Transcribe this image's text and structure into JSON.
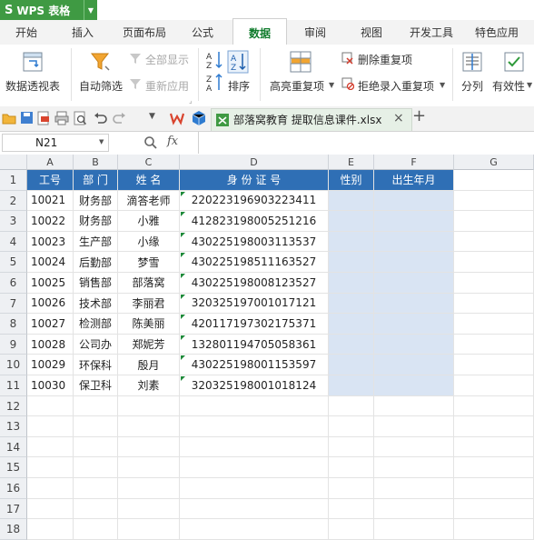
{
  "app": {
    "name": "WPS 表格",
    "logo_letter": "S"
  },
  "menu": {
    "tabs": [
      {
        "label": "开始"
      },
      {
        "label": "插入"
      },
      {
        "label": "页面布局"
      },
      {
        "label": "公式"
      },
      {
        "label": "数据",
        "active": true
      },
      {
        "label": "审阅"
      },
      {
        "label": "视图"
      },
      {
        "label": "开发工具"
      },
      {
        "label": "特色应用"
      }
    ]
  },
  "ribbon": {
    "pivot": "数据透视表",
    "autofilter": "自动筛选",
    "show_all": "全部显示",
    "reapply": "重新应用",
    "sort": "排序",
    "highlight_dup": "高亮重复项",
    "remove_dup": "删除重复项",
    "reject_dup": "拒绝录入重复项",
    "split": "分列",
    "validity": "有效性"
  },
  "doc_tab": {
    "title": "部落窝教育 提取信息课件.xlsx",
    "close": "×",
    "add": "+"
  },
  "formula_bar": {
    "cell_ref": "N21",
    "fx": "fx",
    "zoom_icon": "magnifier-icon",
    "content": ""
  },
  "columns": [
    "A",
    "B",
    "C",
    "D",
    "E",
    "F",
    "G"
  ],
  "table": {
    "headers": [
      "工号",
      "部  门",
      "姓  名",
      "身 份 证 号",
      "性别",
      "出生年月"
    ],
    "rows": [
      [
        "10021",
        "财务部",
        "滴答老师",
        "220223196903223411"
      ],
      [
        "10022",
        "财务部",
        "小雅",
        "412823198005251216"
      ],
      [
        "10023",
        "生产部",
        "小缘",
        "430225198003113537"
      ],
      [
        "10024",
        "后勤部",
        "梦雪",
        "430225198511163527"
      ],
      [
        "10025",
        "销售部",
        "部落窝",
        "430225198008123527"
      ],
      [
        "10026",
        "技术部",
        "李丽君",
        "320325197001017121"
      ],
      [
        "10027",
        "检测部",
        "陈美丽",
        "420117197302175371"
      ],
      [
        "10028",
        "公司办",
        "郑妮芳",
        "132801194705058361"
      ],
      [
        "10029",
        "环保科",
        "殷月",
        "430225198001153597"
      ],
      [
        "10030",
        "保卫科",
        "刘素",
        "320325198001018124"
      ]
    ]
  },
  "row_numbers": [
    "1",
    "2",
    "3",
    "4",
    "5",
    "6",
    "7",
    "8",
    "9",
    "10",
    "11",
    "12",
    "13",
    "14",
    "15",
    "16",
    "17",
    "18"
  ],
  "colors": {
    "brand": "#3f9a43",
    "header_fill": "#2f6fb5",
    "empty_fill": "#d9e4f3",
    "active_tab": "#0f7b2c"
  }
}
